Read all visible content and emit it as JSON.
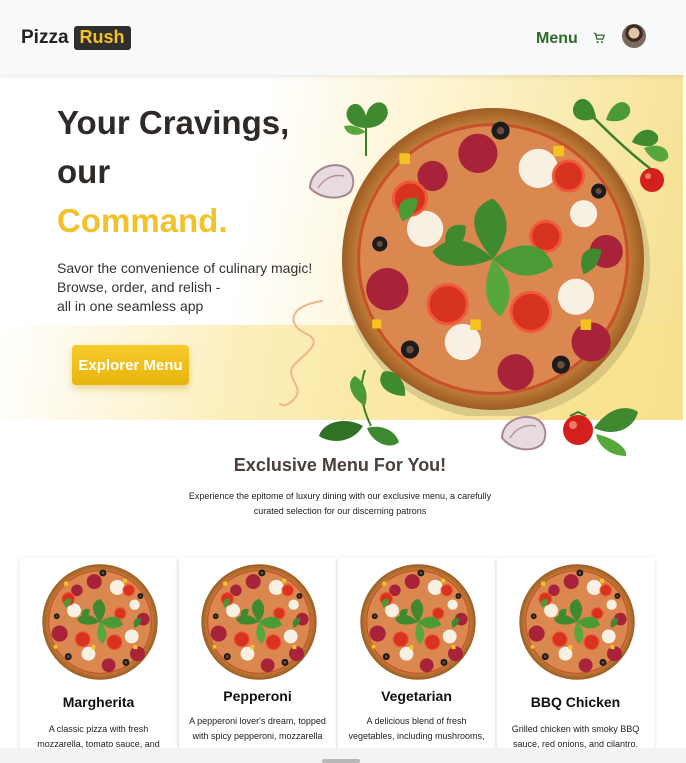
{
  "brand": {
    "first": "Pizza",
    "second": "Rush"
  },
  "nav": {
    "menu_label": "Menu",
    "cart_icon": "cart-icon",
    "avatar_icon": "user-avatar"
  },
  "hero": {
    "title_line1": "Your Cravings,",
    "title_line2": "our",
    "title_accent": "Command.",
    "desc_line1": "Savor the convenience of culinary magic!",
    "desc_line2": "Browse, order, and relish -",
    "desc_line3": "all in one seamless app",
    "button_label": "Explorer Menu"
  },
  "section": {
    "title": "Exclusive Menu For You!",
    "subtitle": "Experience the epitome of luxury dining with our exclusive menu, a carefully curated selection for our discerning patrons"
  },
  "menu_items": [
    {
      "name": "Margherita",
      "desc": "A classic pizza with fresh mozzarella, tomato sauce, and basil."
    },
    {
      "name": "Pepperoni",
      "desc": "A pepperoni lover's dream, topped with spicy pepperoni, mozzarella"
    },
    {
      "name": "Vegetarian",
      "desc": "A delicious blend of fresh vegetables, including mushrooms,"
    },
    {
      "name": "BBQ Chicken",
      "desc": "Grilled chicken with smoky BBQ sauce, red onions, and cilantro."
    }
  ],
  "colors": {
    "accent": "#f1c22a",
    "nav_green": "#2d6a2b",
    "dark": "#2f2a28"
  }
}
